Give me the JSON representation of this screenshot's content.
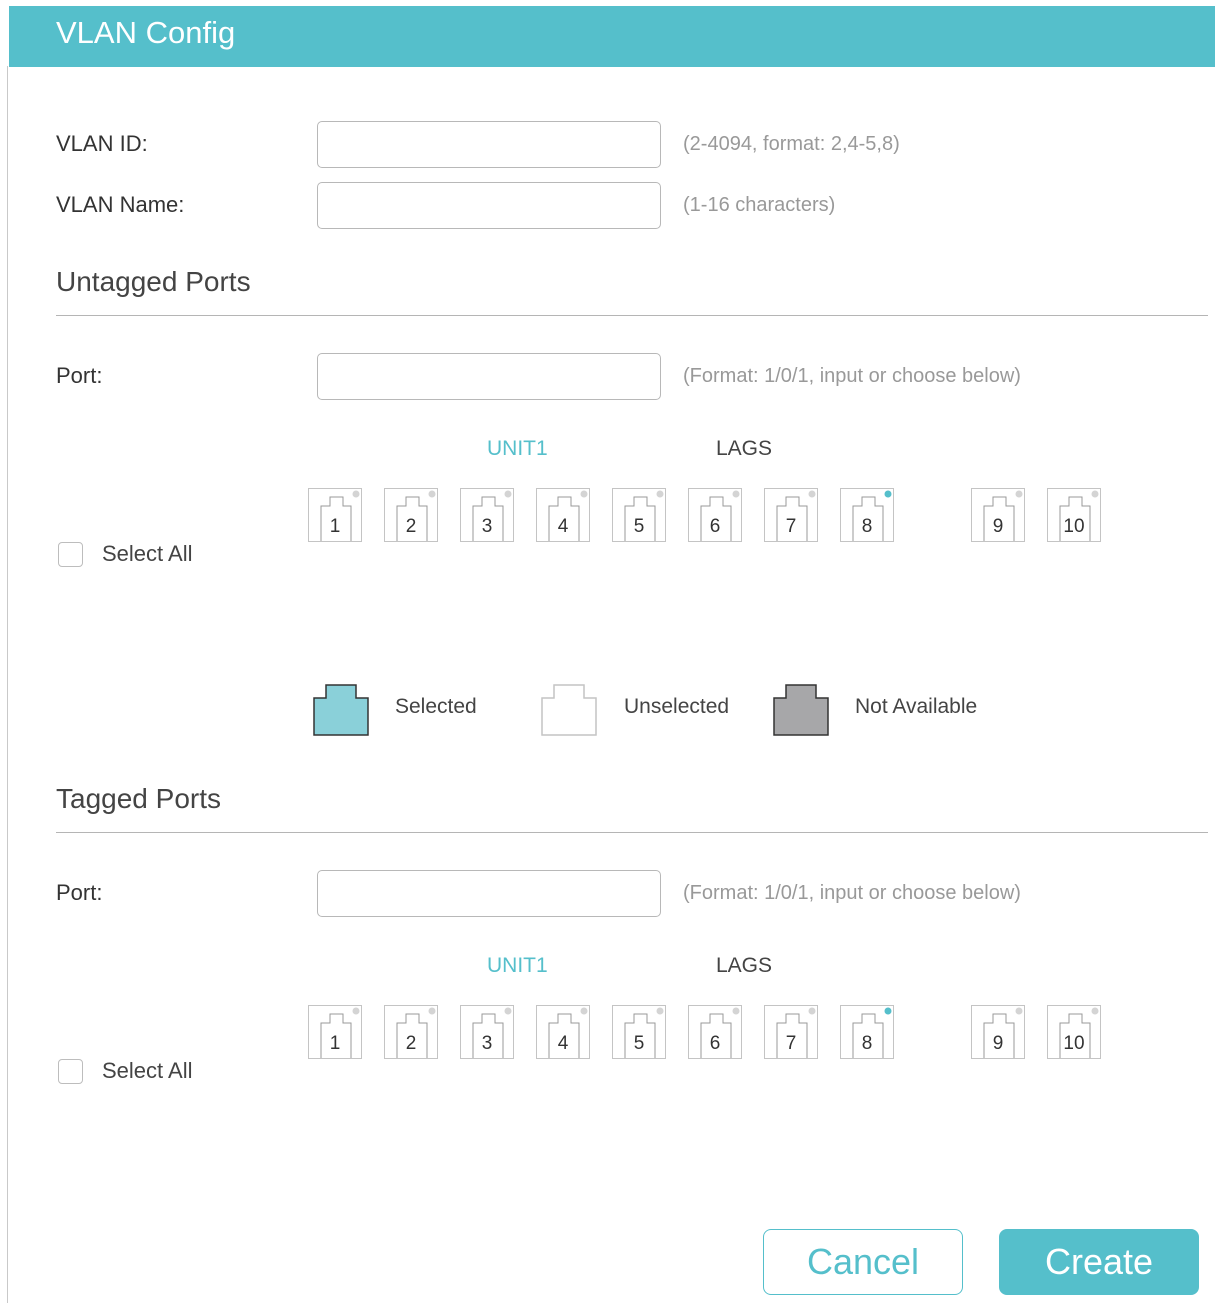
{
  "dialog": {
    "title": "VLAN Config"
  },
  "vlan_id": {
    "label": "VLAN ID:",
    "value": "",
    "hint": "(2-4094, format: 2,4-5,8)"
  },
  "vlan_name": {
    "label": "VLAN Name:",
    "value": "",
    "hint": "(1-16 characters)"
  },
  "untagged": {
    "title": "Untagged Ports",
    "port_label": "Port:",
    "port_value": "",
    "port_hint": "(Format: 1/0/1, input or choose below)",
    "unit_label": "UNIT1",
    "lags_label": "LAGS",
    "select_all": "Select All",
    "unit_ports": [
      "1",
      "2",
      "3",
      "4",
      "5",
      "6",
      "7",
      "8"
    ],
    "lag_ports": [
      "9",
      "10"
    ]
  },
  "legend": {
    "selected": "Selected",
    "unselected": "Unselected",
    "not_available": "Not Available"
  },
  "tagged": {
    "title": "Tagged Ports",
    "port_label": "Port:",
    "port_value": "",
    "port_hint": "(Format: 1/0/1, input or choose below)",
    "unit_label": "UNIT1",
    "lags_label": "LAGS",
    "select_all": "Select All",
    "unit_ports": [
      "1",
      "2",
      "3",
      "4",
      "5",
      "6",
      "7",
      "8"
    ],
    "lag_ports": [
      "9",
      "10"
    ]
  },
  "buttons": {
    "cancel": "Cancel",
    "create": "Create"
  },
  "colors": {
    "accent": "#55bfcb",
    "selected_fill": "#8ad0d9",
    "unavailable_fill": "#a7a7a9",
    "port_indicator_idle": "#d4d4d4",
    "port_indicator_active": "#55bfcb"
  },
  "ports_with_active_indicator": [
    "8"
  ]
}
